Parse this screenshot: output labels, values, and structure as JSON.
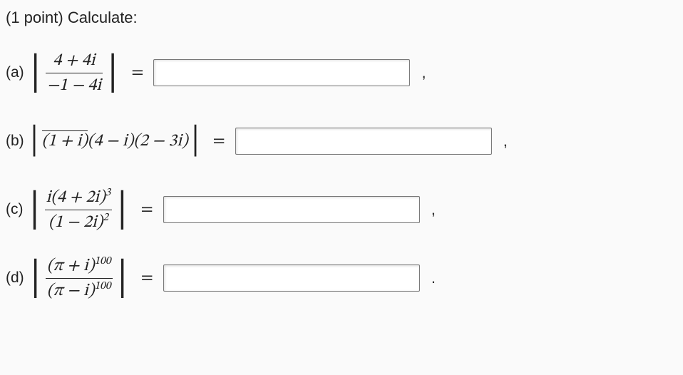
{
  "prompt": "(1 point) Calculate:",
  "parts": {
    "a": {
      "label": "(a)",
      "num": "4 + 4i",
      "den": "−1 − 4i",
      "eq": "=",
      "punct": ","
    },
    "b": {
      "label": "(b)",
      "factor1": "(1 + i)",
      "factor2": "(4 − i)(2 − 3i)",
      "eq": "=",
      "punct": ","
    },
    "c": {
      "label": "(c)",
      "num_base": "i(4 + 2i)",
      "num_exp": "3",
      "den_base": "(1 − 2i)",
      "den_exp": "2",
      "eq": "=",
      "punct": ","
    },
    "d": {
      "label": "(d)",
      "num_base": "(π + i)",
      "num_exp": "100",
      "den_base": "(π − i)",
      "den_exp": "100",
      "eq": "=",
      "punct": "."
    }
  }
}
